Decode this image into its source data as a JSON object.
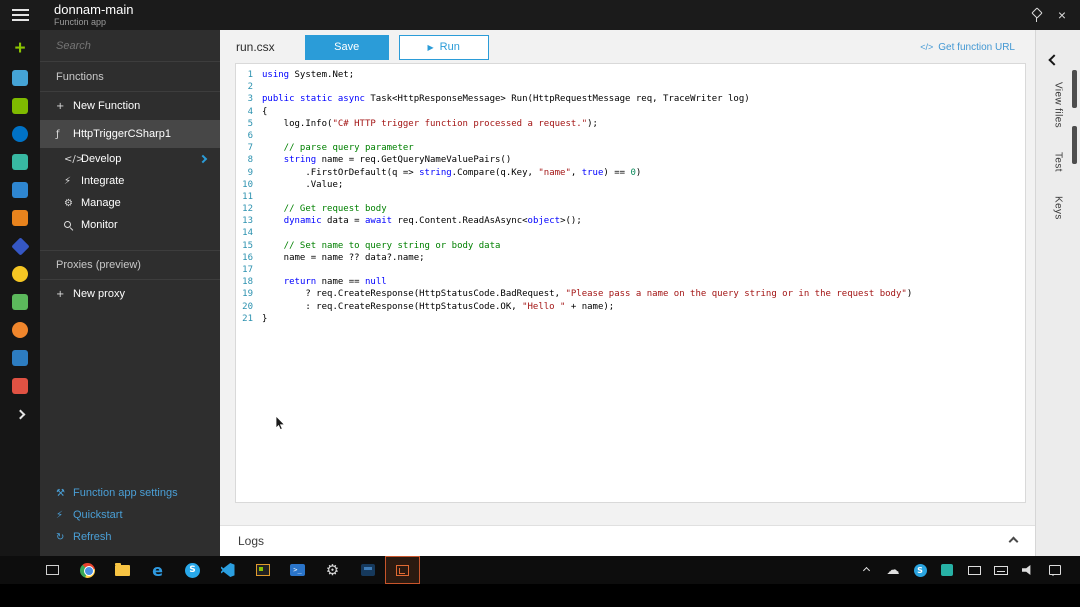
{
  "colors": {
    "accent_blue": "#2b9cd8",
    "link_blue": "#4197d3",
    "sidebar_link_blue": "#4a9fd6",
    "code_keyword": "#0000ff",
    "code_string": "#a31515",
    "code_comment": "#008000",
    "code_number": "#09885a",
    "line_number_blue": "#2b91af"
  },
  "titlebar": {
    "title": "donnam-main",
    "subtitle": "Function app",
    "close_glyph": "×"
  },
  "iconbar": {
    "icons": [
      {
        "name": "new-resource-plus-icon",
        "kind": "plus",
        "glyph": "+",
        "color": "#8ac402"
      },
      {
        "name": "favorite-service-icon-1",
        "kind": "sq",
        "color": "#45a4d6"
      },
      {
        "name": "favorite-service-icon-2",
        "kind": "sq",
        "color": "#7fba00"
      },
      {
        "name": "favorite-service-icon-3",
        "kind": "ci",
        "color": "#0072c6"
      },
      {
        "name": "favorite-service-icon-4",
        "kind": "sq",
        "color": "#38b8a2"
      },
      {
        "name": "favorite-service-icon-5",
        "kind": "sq",
        "color": "#2e86d0"
      },
      {
        "name": "favorite-service-icon-6",
        "kind": "sq",
        "color": "#e8831d"
      },
      {
        "name": "favorite-service-icon-7",
        "kind": "di",
        "color": "#3557c4"
      },
      {
        "name": "favorite-service-icon-8",
        "kind": "ci",
        "color": "#f5c623"
      },
      {
        "name": "favorite-service-icon-9",
        "kind": "sq",
        "color": "#5cb85c"
      },
      {
        "name": "favorite-service-icon-10",
        "kind": "ci",
        "color": "#f0862c"
      },
      {
        "name": "favorite-service-icon-11",
        "kind": "sq",
        "color": "#2d7dc1"
      },
      {
        "name": "favorite-service-icon-12",
        "kind": "sq",
        "color": "#e05243"
      },
      {
        "name": "more-services-chevron",
        "kind": "chev"
      }
    ]
  },
  "sidebar": {
    "search_placeholder": "Search",
    "functions_header": "Functions",
    "proxies_header": "Proxies (preview)",
    "items": [
      {
        "name": "new-function",
        "label": "New Function",
        "glyph": "+"
      },
      {
        "name": "function-httptriggercsharp1",
        "label": "HttpTriggerCSharp1",
        "glyph": "ƒ",
        "selected": true
      },
      {
        "name": "develop",
        "label": "Develop",
        "glyph": "</>",
        "indent": true,
        "chevron": true
      },
      {
        "name": "integrate",
        "label": "Integrate",
        "glyph": "⚡",
        "indent": true
      },
      {
        "name": "manage",
        "label": "Manage",
        "glyph": "⚙",
        "indent": true
      },
      {
        "name": "monitor",
        "label": "Monitor",
        "magnifier": true,
        "indent": true
      }
    ],
    "proxy_items": [
      {
        "name": "new-proxy",
        "label": "New proxy",
        "glyph": "+"
      }
    ],
    "footer_links": [
      {
        "name": "function-app-settings",
        "label": "Function app settings",
        "glyph": "⚒"
      },
      {
        "name": "quickstart",
        "label": "Quickstart",
        "glyph": "⚡"
      },
      {
        "name": "refresh",
        "label": "Refresh",
        "glyph": "↻"
      }
    ]
  },
  "toolbar": {
    "filename": "run.csx",
    "save_label": "Save",
    "run_label": "Run",
    "run_play_glyph": "▶",
    "code_glyph": "</>",
    "get_function_url_label": "Get function URL"
  },
  "editor": {
    "lines": [
      {
        "segs": [
          {
            "c": "k",
            "t": "using"
          },
          {
            "c": "p",
            "t": " System.Net;"
          }
        ]
      },
      {
        "segs": []
      },
      {
        "segs": [
          {
            "c": "k",
            "t": "public"
          },
          {
            "c": "p",
            "t": " "
          },
          {
            "c": "k",
            "t": "static"
          },
          {
            "c": "p",
            "t": " "
          },
          {
            "c": "k",
            "t": "async"
          },
          {
            "c": "p",
            "t": " Task<HttpResponseMessage> Run(HttpRequestMessage req, TraceWriter log)"
          }
        ]
      },
      {
        "segs": [
          {
            "c": "p",
            "t": "{"
          }
        ]
      },
      {
        "segs": [
          {
            "c": "p",
            "t": "    log.Info("
          },
          {
            "c": "s",
            "t": "\"C# HTTP trigger function processed a request.\""
          },
          {
            "c": "p",
            "t": ");"
          }
        ]
      },
      {
        "segs": []
      },
      {
        "segs": [
          {
            "c": "c",
            "t": "    // parse query parameter"
          }
        ]
      },
      {
        "segs": [
          {
            "c": "p",
            "t": "    "
          },
          {
            "c": "k",
            "t": "string"
          },
          {
            "c": "p",
            "t": " name = req.GetQueryNameValuePairs()"
          }
        ]
      },
      {
        "segs": [
          {
            "c": "p",
            "t": "        .FirstOrDefault(q => "
          },
          {
            "c": "k",
            "t": "string"
          },
          {
            "c": "p",
            "t": ".Compare(q.Key, "
          },
          {
            "c": "s",
            "t": "\"name\""
          },
          {
            "c": "p",
            "t": ", "
          },
          {
            "c": "k",
            "t": "true"
          },
          {
            "c": "p",
            "t": ") == "
          },
          {
            "c": "n",
            "t": "0"
          },
          {
            "c": "p",
            "t": ")"
          }
        ]
      },
      {
        "segs": [
          {
            "c": "p",
            "t": "        .Value;"
          }
        ]
      },
      {
        "segs": []
      },
      {
        "segs": [
          {
            "c": "c",
            "t": "    // Get request body"
          }
        ]
      },
      {
        "segs": [
          {
            "c": "p",
            "t": "    "
          },
          {
            "c": "k",
            "t": "dynamic"
          },
          {
            "c": "p",
            "t": " data = "
          },
          {
            "c": "k",
            "t": "await"
          },
          {
            "c": "p",
            "t": " req.Content.ReadAsAsync<"
          },
          {
            "c": "k",
            "t": "object"
          },
          {
            "c": "p",
            "t": ">();"
          }
        ]
      },
      {
        "segs": []
      },
      {
        "segs": [
          {
            "c": "c",
            "t": "    // Set name to query string or body data"
          }
        ]
      },
      {
        "segs": [
          {
            "c": "p",
            "t": "    name = name ?? data?.name;"
          }
        ]
      },
      {
        "segs": []
      },
      {
        "segs": [
          {
            "c": "p",
            "t": "    "
          },
          {
            "c": "k",
            "t": "return"
          },
          {
            "c": "p",
            "t": " name == "
          },
          {
            "c": "k",
            "t": "null"
          }
        ]
      },
      {
        "segs": [
          {
            "c": "p",
            "t": "        ? req.CreateResponse(HttpStatusCode.BadRequest, "
          },
          {
            "c": "s",
            "t": "\"Please pass a name on the query string or in the request body\""
          },
          {
            "c": "p",
            "t": ")"
          }
        ]
      },
      {
        "segs": [
          {
            "c": "p",
            "t": "        : req.CreateResponse(HttpStatusCode.OK, "
          },
          {
            "c": "s",
            "t": "\"Hello \""
          },
          {
            "c": "p",
            "t": " + name);"
          }
        ]
      },
      {
        "segs": [
          {
            "c": "p",
            "t": "}"
          }
        ]
      }
    ]
  },
  "right_panel": {
    "tabs": [
      {
        "name": "view-files",
        "label": "View files"
      },
      {
        "name": "test",
        "label": "Test"
      },
      {
        "name": "keys",
        "label": "Keys"
      }
    ]
  },
  "logs": {
    "label": "Logs"
  },
  "taskbar": {
    "apps": [
      {
        "name": "windows-start-button",
        "kind": "start"
      },
      {
        "name": "task-view-button",
        "kind": "taskview"
      },
      {
        "name": "chrome-icon",
        "kind": "chrome"
      },
      {
        "name": "file-explorer-icon",
        "kind": "folder"
      },
      {
        "name": "edge-icon",
        "kind": "edge",
        "glyph": "e"
      },
      {
        "name": "skype-icon",
        "kind": "skype",
        "glyph": "S"
      },
      {
        "name": "vscode-icon",
        "kind": "vscode"
      },
      {
        "name": "function-cli-terminal-icon",
        "kind": "term"
      },
      {
        "name": "powershell-icon",
        "kind": "ps",
        "glyph": ">_"
      },
      {
        "name": "settings-gear-icon",
        "kind": "gear",
        "glyph": "⚙"
      },
      {
        "name": "blue-app-icon",
        "kind": "darkapp"
      },
      {
        "name": "active-terminal-app-icon",
        "kind": "active",
        "active": true
      }
    ],
    "tray": [
      {
        "name": "hidden-icons-chevron",
        "kind": "chevup"
      },
      {
        "name": "onedrive-icon",
        "kind": "cloud",
        "glyph": "☁"
      },
      {
        "name": "skype-tray-icon",
        "kind": "skypedot",
        "glyph": "S"
      },
      {
        "name": "network-tray-icon",
        "kind": "tealsq"
      },
      {
        "name": "display-tray-icon",
        "kind": "monitor"
      },
      {
        "name": "touch-keyboard-icon",
        "kind": "keyboard"
      },
      {
        "name": "volume-icon",
        "kind": "speaker"
      },
      {
        "name": "action-center-icon",
        "kind": "ac"
      }
    ]
  }
}
